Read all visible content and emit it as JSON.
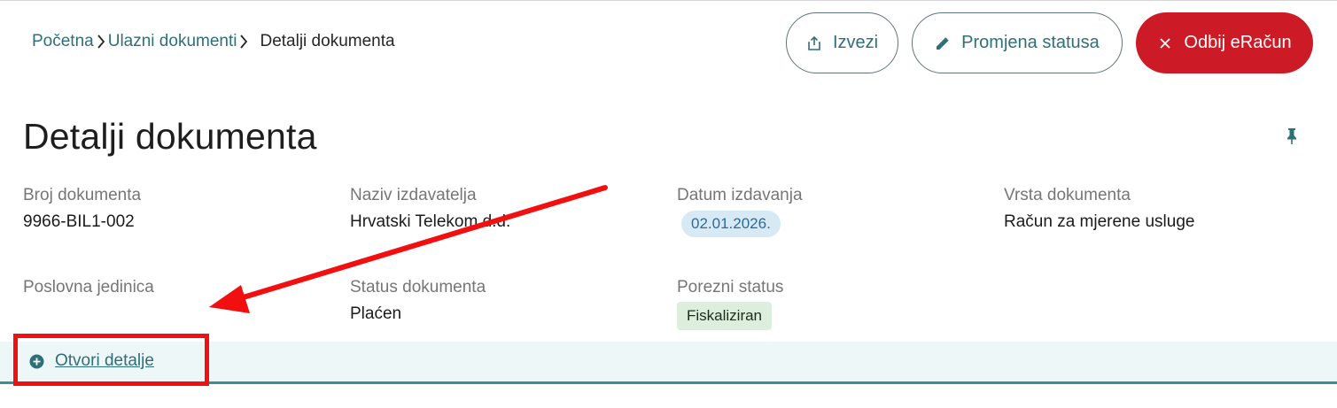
{
  "breadcrumb": {
    "home": "Početna",
    "inbox": "Ulazni dokumenti",
    "current": "Detalji dokumenta"
  },
  "actions": {
    "export_label": "Izvezi",
    "change_status_label": "Promjena statusa",
    "reject_label": "Odbij eRačun"
  },
  "page": {
    "title": "Detalji dokumenta"
  },
  "fields": {
    "document_number": {
      "label": "Broj dokumenta",
      "value": "9966-BIL1-002"
    },
    "issuer_name": {
      "label": "Naziv izdavatelja",
      "value": "Hrvatski Telekom d.d."
    },
    "issue_date": {
      "label": "Datum izdavanja",
      "value": "02.01.2026."
    },
    "document_type": {
      "label": "Vrsta dokumenta",
      "value": "Račun za mjerene usluge"
    },
    "business_unit": {
      "label": "Poslovna jedinica",
      "value": ""
    },
    "document_status": {
      "label": "Status dokumenta",
      "value": "Plaćen"
    },
    "tax_status": {
      "label": "Porezni status",
      "value": "Fiskaliziran"
    }
  },
  "details": {
    "open_label": "Otvori detalje"
  },
  "icons": {
    "breadcrumb_separator": "chevron-right-icon",
    "export": "share-icon",
    "change_status": "pencil-icon",
    "reject": "close-icon",
    "pin": "pin-icon",
    "open_details": "plus-circle-icon"
  },
  "colors": {
    "accent": "#2f6f79",
    "danger": "#cc1a26",
    "annotation": "#f20f0f",
    "date_pill_bg": "#d8e9f6",
    "tag_bg": "#dcefdd",
    "details_bg": "#eef7f8"
  }
}
